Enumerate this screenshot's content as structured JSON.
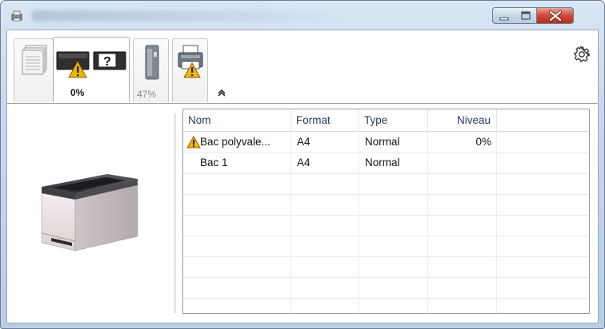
{
  "window": {
    "title": "",
    "controls": {
      "minimize_icon": "minimize-icon",
      "maximize_icon": "maximize-icon",
      "close_icon": "close-icon"
    }
  },
  "toolbar": {
    "tabs": [
      {
        "name": "pages",
        "label": "",
        "icon": "pages-icon"
      },
      {
        "name": "toner",
        "label": "0%",
        "icon": "toner-warning-icon",
        "selected": true,
        "level": 0
      },
      {
        "name": "waste-toner",
        "label": "47%",
        "icon": "waste-toner-icon",
        "level": 47
      },
      {
        "name": "paper",
        "label": "",
        "icon": "printer-paper-warning-icon"
      }
    ],
    "settings_icon": "gear-icon",
    "collapse_icon": "chevron-up-icon"
  },
  "table": {
    "columns": [
      "Nom",
      "Format",
      "Type",
      "Niveau"
    ],
    "rows": [
      {
        "warning": true,
        "name": "Bac polyvale...",
        "format": "A4",
        "type": "Normal",
        "level": "0%"
      },
      {
        "warning": false,
        "name": "Bac 1",
        "format": "A4",
        "type": "Normal",
        "level": ""
      }
    ]
  },
  "colors": {
    "warning": "#f2b705",
    "close_button": "#c8453a",
    "header_text": "#1e395b"
  }
}
